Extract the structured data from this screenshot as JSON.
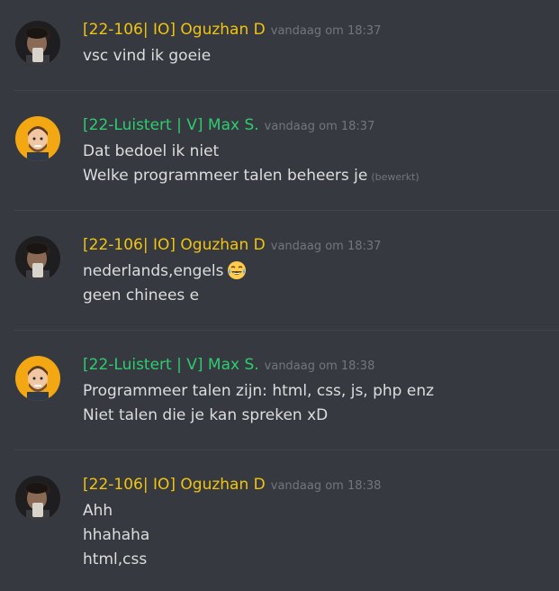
{
  "colors": {
    "background": "#36393f",
    "divider": "#42454a",
    "text": "#dcddde",
    "muted": "#72767d",
    "user_oguzhan": "#f1c40f",
    "user_max": "#2ecc71"
  },
  "messages": [
    {
      "username": "[22-106| IO] Oguzhan D",
      "timestamp": "vandaag om 18:37",
      "avatar": "photo-avatar",
      "lines": [
        "vsc vind ik goeie"
      ]
    },
    {
      "username": "[22-Luistert | V] Max S.",
      "timestamp": "vandaag om 18:37",
      "avatar": "cartoon-avatar",
      "lines": [
        "Dat bedoel ik niet",
        "Welke programmeer talen beheers je"
      ],
      "edited_label": "(bewerkt)"
    },
    {
      "username": "[22-106| IO] Oguzhan D",
      "timestamp": "vandaag om 18:37",
      "avatar": "photo-avatar",
      "lines": [
        "nederlands,engels",
        "geen chinees e"
      ],
      "emoji": "joy-emoji"
    },
    {
      "username": "[22-Luistert | V] Max S.",
      "timestamp": "vandaag om 18:38",
      "avatar": "cartoon-avatar",
      "lines": [
        "Programmeer talen zijn: html, css, js, php enz",
        "Niet talen die je kan spreken xD"
      ]
    },
    {
      "username": "[22-106| IO] Oguzhan D",
      "timestamp": "vandaag om 18:38",
      "avatar": "photo-avatar",
      "lines": [
        "Ahh",
        "hhahaha",
        "html,css"
      ]
    }
  ]
}
